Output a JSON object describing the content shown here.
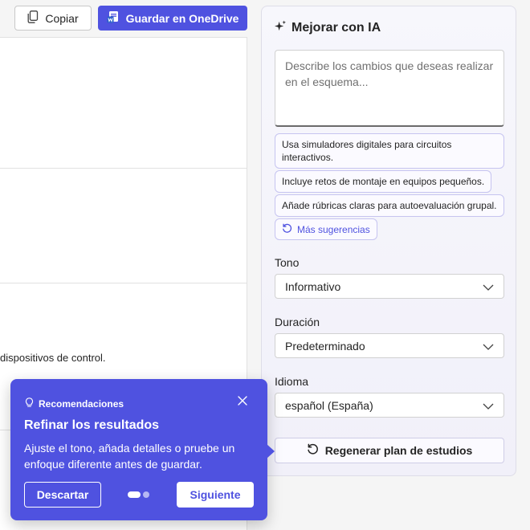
{
  "toolbar": {
    "copy_label": "Copiar",
    "save_onedrive_label": "Guardar en OneDrive"
  },
  "document": {
    "visible_snippet": "dispositivos de control."
  },
  "ai_panel": {
    "title": "Mejorar con IA",
    "prompt_placeholder": "Describe los cambios que deseas realizar en el esquema...",
    "prompt_value": "",
    "suggestions": [
      "Usa simuladores digitales para circuitos interactivos.",
      "Incluye retos de montaje en equipos pequeños.",
      "Añade rúbricas claras para autoevaluación grupal."
    ],
    "more_suggestions_label": "Más sugerencias",
    "tone": {
      "label": "Tono",
      "selected": "Informativo"
    },
    "duration": {
      "label": "Duración",
      "selected": "Predeterminado"
    },
    "language": {
      "label": "Idioma",
      "selected": "español (España)"
    },
    "regenerate_label": "Regenerar plan de estudios"
  },
  "popover": {
    "eyebrow": "Recomendaciones",
    "title": "Refinar los resultados",
    "body": "Ajuste el tono, añada detalles o pruebe un enfoque diferente antes de guardar.",
    "dismiss_label": "Descartar",
    "next_label": "Siguiente",
    "step_current": 1,
    "step_total": 2
  },
  "colors": {
    "accent": "#4f52e0",
    "panel_bg": "#f4f3fb",
    "chip_border": "#c6c4f0"
  }
}
